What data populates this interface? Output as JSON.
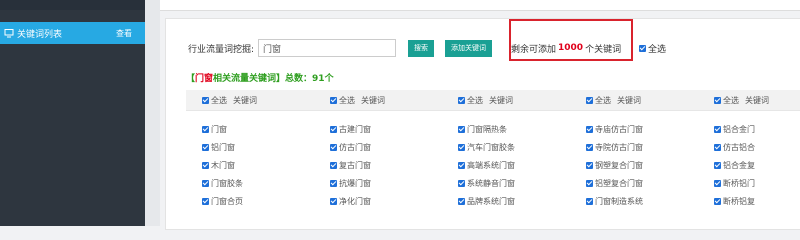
{
  "sidebar": {
    "item": {
      "label": "关键词列表",
      "action": "查看",
      "icon": "monitor-icon"
    }
  },
  "search": {
    "label": "行业流量词挖掘:",
    "value": "门窗",
    "search_button": "搜索",
    "add_button": "添加关键词"
  },
  "remaining": {
    "prefix": "剩余可添加",
    "count": "1000",
    "suffix": "个关键词"
  },
  "select_all": "全选",
  "summary": {
    "bracket_open": "【",
    "keyword": "门窗",
    "middle": "相关流量关键词】总数：",
    "total": "91个"
  },
  "table": {
    "header_select_all": "全选",
    "header_keyword": "关键词",
    "columns": [
      [
        "门窗",
        "铝门窗",
        "木门窗",
        "门窗胶条",
        "门窗合页"
      ],
      [
        "古建门窗",
        "仿古门窗",
        "复古门窗",
        "抗爆门窗",
        "净化门窗"
      ],
      [
        "门窗隔热条",
        "汽车门窗胶条",
        "高端系统门窗",
        "系统静音门窗",
        "品牌系统门窗"
      ],
      [
        "寺庙仿古门窗",
        "寺院仿古门窗",
        "钢塑复合门窗",
        "铝塑复合门窗",
        "门窗制造系统"
      ],
      [
        "铝合金门",
        "仿古铝合",
        "铝合金复",
        "断桥铝门",
        "断桥铝复"
      ]
    ]
  },
  "colors": {
    "sidebar_bg": "#2e363f",
    "active": "#27a9e3",
    "button": "#1aa094",
    "accent_red": "#e0001b",
    "green": "#2e9e1f"
  }
}
